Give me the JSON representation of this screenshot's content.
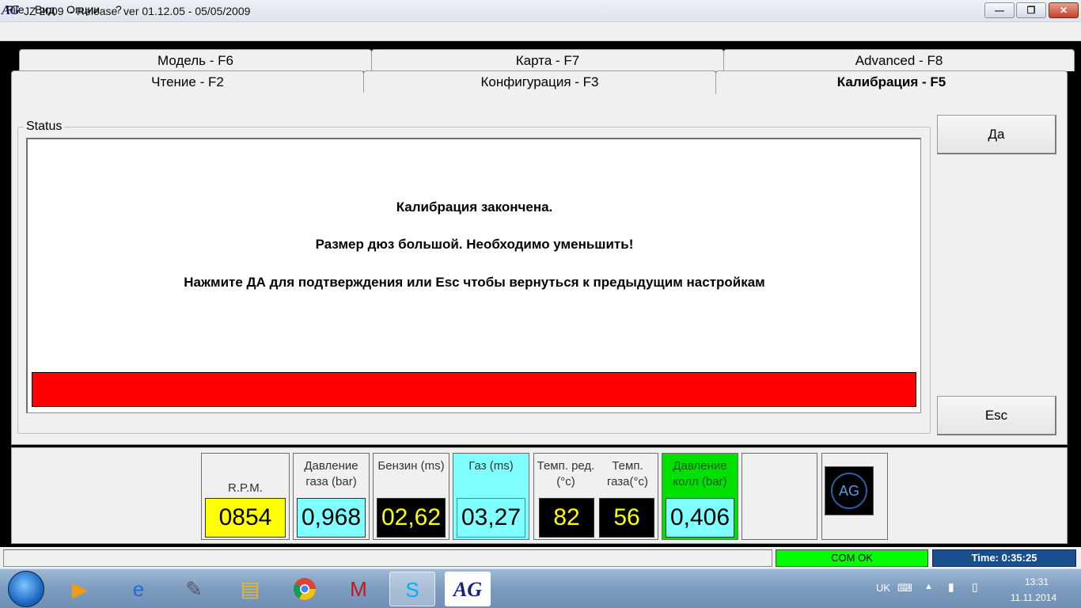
{
  "window": {
    "logo": "AG",
    "title": "JZ 2009  - Release  ver 01.12.05 - 05/05/2009",
    "min_glyph": "—",
    "max_glyph": "❐",
    "close_glyph": "✕"
  },
  "menu": {
    "file": "File",
    "view": "Вид",
    "options": "Опции",
    "help": "?"
  },
  "tabs": {
    "model": "Модель - F6",
    "map": "Карта - F7",
    "advanced": "Advanced - F8",
    "read": "Чтение - F2",
    "config": "Конфигурация - F3",
    "calibration": "Калибрация - F5",
    "active": "calibration"
  },
  "status": {
    "legend": "Status",
    "line1": "Калибрация закончена.",
    "line2": "Размер дюз большой. Необходимо уменьшить!",
    "line3": "Нажмите ДА для подтверждения или Esc чтобы вернуться к предыдущим настройкам",
    "bar_color": "#ff0000"
  },
  "buttons": {
    "yes": "Да",
    "esc": "Esc"
  },
  "gauges": {
    "rpm": {
      "label": "R.P.M.",
      "value": "0854",
      "bg": "#ffff00",
      "fg": "#000000"
    },
    "gas_pressure": {
      "label": "Давление газа (bar)",
      "value": "0,968",
      "bg": "#80ffff",
      "fg": "#000000"
    },
    "petrol": {
      "label": "Бензин (ms)",
      "value": "02,62",
      "bg": "#000000",
      "fg": "#ffff00"
    },
    "gas": {
      "label": "Газ (ms)",
      "value": "03,27",
      "bg": "#80ffff",
      "fg": "#000000"
    },
    "temp_red": {
      "label": "Темп. ред.(°c)",
      "value": "82",
      "bg": "#000000",
      "fg": "#ffff00"
    },
    "temp_gas": {
      "label": "Темп. газа(°c)",
      "value": "56",
      "bg": "#000000",
      "fg": "#ffff00"
    },
    "coll_pressure": {
      "label": "Давление колл (bar)",
      "value": "0,406",
      "bg": "#80ffff",
      "fg": "#000000"
    },
    "logo": "AG"
  },
  "statusbar": {
    "com": "COM OK",
    "time": "Time: 0:35:25"
  },
  "taskbar": {
    "icons": [
      "media-player-icon",
      "internet-explorer-icon",
      "tools-icon",
      "folder-icon",
      "chrome-icon",
      "mcafee-icon",
      "skype-icon",
      "ag-app-icon"
    ],
    "glyphs": {
      "media": "▶",
      "ie": "e",
      "tool": "✎",
      "folder": "▤",
      "chrome": "◉",
      "mcafee": "M",
      "skype": "S",
      "ag": "AG"
    },
    "lang": "UK",
    "kbd": "⌨",
    "up": "▲",
    "net": "▮",
    "bat": "▯",
    "clock_time": "13:31",
    "clock_date": "11.11.2014"
  }
}
